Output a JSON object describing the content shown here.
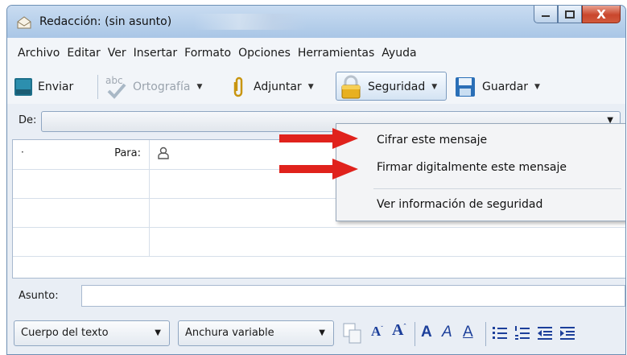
{
  "window": {
    "title": "Redacción: (sin asunto)",
    "close_glyph": "X"
  },
  "menubar": {
    "items": [
      "Archivo",
      "Editar",
      "Ver",
      "Insertar",
      "Formato",
      "Opciones",
      "Herramientas",
      "Ayuda"
    ]
  },
  "toolbar": {
    "send_label": "Enviar",
    "spell_label": "Ortografía",
    "spell_badge": "abc",
    "attach_label": "Adjuntar",
    "security_label": "Seguridad",
    "save_label": "Guardar"
  },
  "from_row": {
    "label": "De:"
  },
  "recipients": {
    "type_label": "Para:",
    "row_count": 4
  },
  "subject": {
    "label": "Asunto:",
    "value": ""
  },
  "format_bar": {
    "paragraph_style": "Cuerpo del texto",
    "font": "Anchura variable"
  },
  "security_menu": {
    "items": [
      "Cifrar este mensaje",
      "Firmar digitalmente este mensaje",
      "Ver información de seguridad"
    ]
  },
  "colors": {
    "arrow": "#e0221c",
    "accent": "#1c3f9a"
  },
  "icons": [
    "mail-icon",
    "send-icon",
    "spellcheck-icon",
    "paperclip-icon",
    "padlock-icon",
    "floppy-disk-icon",
    "contact-icon"
  ]
}
